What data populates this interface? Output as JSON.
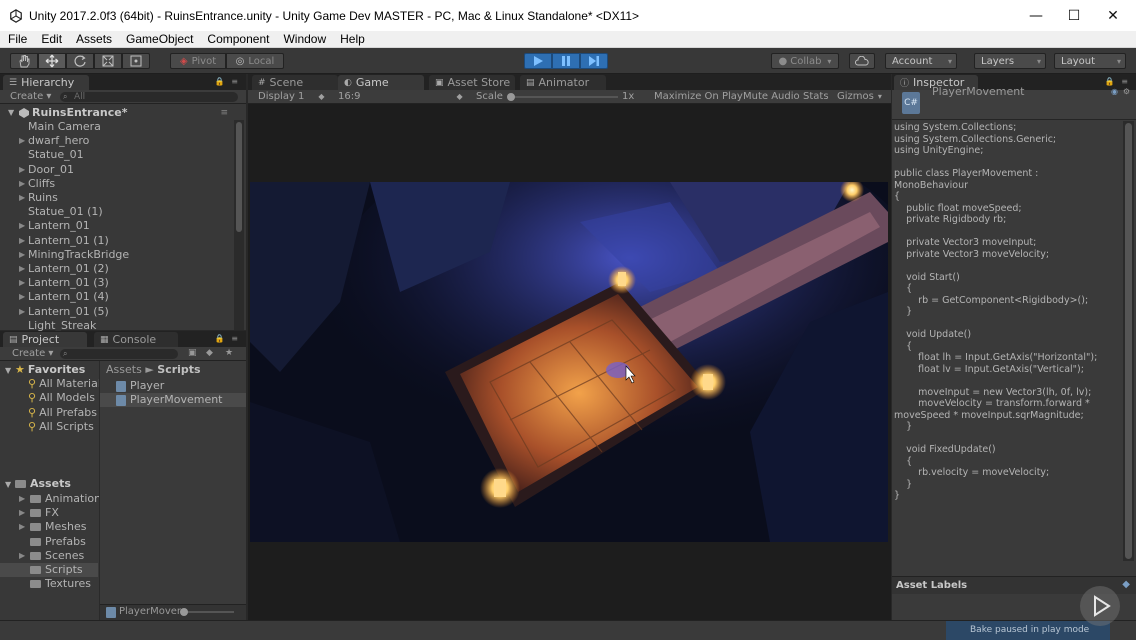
{
  "window": {
    "title": "Unity 2017.2.0f3 (64bit) - RuinsEntrance.unity - Unity Game Dev MASTER - PC, Mac & Linux Standalone* <DX11>",
    "controls": {
      "minimize": "—",
      "maximize": "☐",
      "close": "✕"
    }
  },
  "menu": [
    "File",
    "Edit",
    "Assets",
    "GameObject",
    "Component",
    "Window",
    "Help"
  ],
  "toolbar": {
    "pivot": "Pivot",
    "local": "Local",
    "collab": "Collab",
    "account": "Account",
    "layers": "Layers",
    "layout": "Layout"
  },
  "hierarchy": {
    "tab": "Hierarchy",
    "create": "Create",
    "search_placeholder": "All",
    "scene": "RuinsEntrance*",
    "items": [
      {
        "name": "Main Camera",
        "expandable": false
      },
      {
        "name": "dwarf_hero",
        "expandable": true
      },
      {
        "name": "Statue_01",
        "expandable": false
      },
      {
        "name": "Door_01",
        "expandable": true
      },
      {
        "name": "Cliffs",
        "expandable": true
      },
      {
        "name": "Ruins",
        "expandable": true
      },
      {
        "name": "Statue_01 (1)",
        "expandable": false
      },
      {
        "name": "Lantern_01",
        "expandable": true
      },
      {
        "name": "Lantern_01 (1)",
        "expandable": true
      },
      {
        "name": "MiningTrackBridge",
        "expandable": true
      },
      {
        "name": "Lantern_01 (2)",
        "expandable": true
      },
      {
        "name": "Lantern_01 (3)",
        "expandable": true
      },
      {
        "name": "Lantern_01 (4)",
        "expandable": true
      },
      {
        "name": "Lantern_01 (5)",
        "expandable": true
      },
      {
        "name": "Light_Streak",
        "expandable": false
      }
    ]
  },
  "project": {
    "tabs": [
      "Project",
      "Console"
    ],
    "create": "Create",
    "favorites_label": "Favorites",
    "favorites": [
      "All Materials",
      "All Models",
      "All Prefabs",
      "All Scripts"
    ],
    "assets_label": "Assets",
    "folders": [
      {
        "name": "Animations",
        "expandable": true
      },
      {
        "name": "FX",
        "expandable": true
      },
      {
        "name": "Meshes",
        "expandable": true
      },
      {
        "name": "Prefabs",
        "expandable": false
      },
      {
        "name": "Scenes",
        "expandable": true
      },
      {
        "name": "Scripts",
        "expandable": false
      },
      {
        "name": "Textures",
        "expandable": false
      }
    ],
    "breadcrumb": [
      "Assets",
      "Scripts"
    ],
    "files": [
      "Player",
      "PlayerMovement"
    ],
    "footer_file": "PlayerMover"
  },
  "scene_tabs": [
    "Scene",
    "Game",
    "Asset Store",
    "Animator"
  ],
  "game_bar": {
    "display": "Display 1",
    "aspect": "16:9",
    "scale_label": "Scale",
    "scale_value": "1x",
    "maximize": "Maximize On Play",
    "mute": "Mute Audio",
    "stats": "Stats",
    "gizmos": "Gizmos"
  },
  "inspector": {
    "tab": "Inspector",
    "object": "PlayerMovement",
    "file_icon": "C#",
    "code": "using System.Collections;\nusing System.Collections.Generic;\nusing UnityEngine;\n\npublic class PlayerMovement :\nMonoBehaviour\n{\n    public float moveSpeed;\n    private Rigidbody rb;\n\n    private Vector3 moveInput;\n    private Vector3 moveVelocity;\n\n    void Start()\n    {\n        rb = GetComponent<Rigidbody>();\n    }\n\n    void Update()\n    {\n        float lh = Input.GetAxis(\"Horizontal\");\n        float lv = Input.GetAxis(\"Vertical\");\n\n        moveInput = new Vector3(lh, 0f, lv);\n        moveVelocity = transform.forward *\nmoveSpeed * moveInput.sqrMagnitude;\n    }\n\n    void FixedUpdate()\n    {\n        rb.velocity = moveVelocity;\n    }\n}",
    "asset_labels": "Asset Labels"
  },
  "status": {
    "bake": "Bake paused in play mode"
  },
  "colors": {
    "play_active": "#2e6fb3",
    "background": "#383838"
  }
}
